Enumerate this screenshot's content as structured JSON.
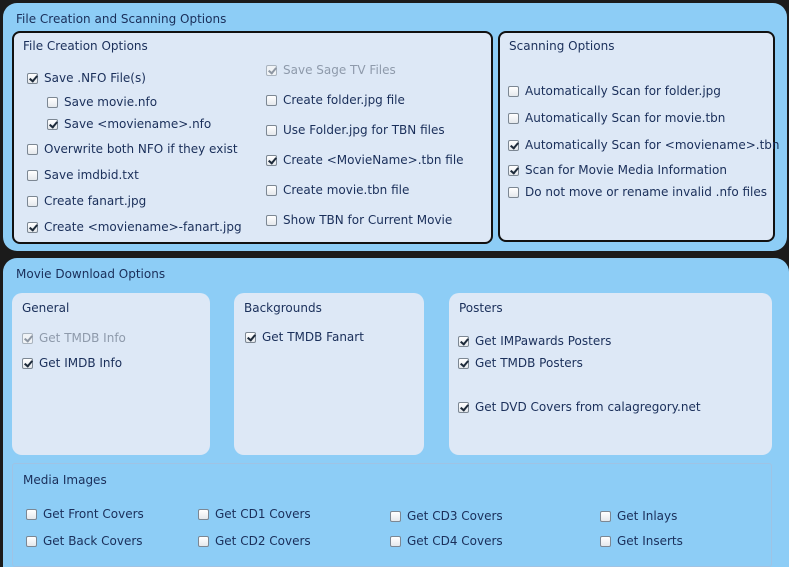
{
  "file_section": {
    "title": "File Creation and Scanning Options",
    "creation": {
      "title": "File Creation Options",
      "save_nfo": {
        "label": "Save .NFO File(s)",
        "checked": true
      },
      "save_movie_nfo": {
        "label": "Save movie.nfo",
        "checked": false
      },
      "save_moviename_nfo": {
        "label": "Save <moviename>.nfo",
        "checked": true
      },
      "overwrite_nfo": {
        "label": "Overwrite both NFO if they exist",
        "checked": false
      },
      "save_imdbid": {
        "label": "Save imdbid.txt",
        "checked": false
      },
      "create_fanart": {
        "label": "Create fanart.jpg",
        "checked": false
      },
      "create_moviename_fanart": {
        "label": "Create <moviename>-fanart.jpg",
        "checked": true
      },
      "save_sage": {
        "label": "Save Sage TV Files",
        "checked": true,
        "disabled": true
      },
      "create_folder_jpg": {
        "label": "Create folder.jpg file",
        "checked": false
      },
      "use_folder_jpg": {
        "label": "Use Folder.jpg for TBN files",
        "checked": false
      },
      "create_moviename_tbn": {
        "label": "Create <MovieName>.tbn file",
        "checked": true
      },
      "create_movie_tbn": {
        "label": "Create movie.tbn file",
        "checked": false
      },
      "show_tbn": {
        "label": "Show TBN for Current Movie",
        "checked": false
      }
    },
    "scanning": {
      "title": "Scanning Options",
      "scan_folder_jpg": {
        "label": "Automatically Scan for folder.jpg",
        "checked": false
      },
      "scan_movie_tbn": {
        "label": "Automatically Scan for movie.tbn",
        "checked": false
      },
      "scan_moviename_tbn": {
        "label": "Automatically Scan for <moviename>.tbn",
        "checked": true
      },
      "scan_media_info": {
        "label": "Scan for Movie Media Information",
        "checked": true
      },
      "no_rename_invalid": {
        "label": "Do not move or rename invalid .nfo files",
        "checked": false
      }
    }
  },
  "download_section": {
    "title": "Movie Download Options",
    "general": {
      "title": "General",
      "tmdb_info": {
        "label": "Get TMDB Info",
        "checked": true,
        "disabled": true
      },
      "imdb_info": {
        "label": "Get IMDB Info",
        "checked": true
      }
    },
    "backgrounds": {
      "title": "Backgrounds",
      "tmdb_fanart": {
        "label": "Get TMDB Fanart",
        "checked": true
      }
    },
    "posters": {
      "title": "Posters",
      "impawards": {
        "label": "Get IMPawards Posters",
        "checked": true
      },
      "tmdb_posters": {
        "label": "Get TMDB Posters",
        "checked": true
      },
      "dvd_covers": {
        "label": "Get DVD Covers from calagregory.net",
        "checked": true
      }
    },
    "media_images": {
      "title": "Media Images",
      "front_covers": {
        "label": "Get Front Covers",
        "checked": false
      },
      "back_covers": {
        "label": "Get Back Covers",
        "checked": false
      },
      "cd1_covers": {
        "label": "Get CD1 Covers",
        "checked": false
      },
      "cd2_covers": {
        "label": "Get CD2 Covers",
        "checked": false
      },
      "cd3_covers": {
        "label": "Get CD3 Covers",
        "checked": false
      },
      "cd4_covers": {
        "label": "Get CD4 Covers",
        "checked": false
      },
      "inlays": {
        "label": "Get Inlays",
        "checked": false
      },
      "inserts": {
        "label": "Get Inserts",
        "checked": false
      }
    }
  }
}
